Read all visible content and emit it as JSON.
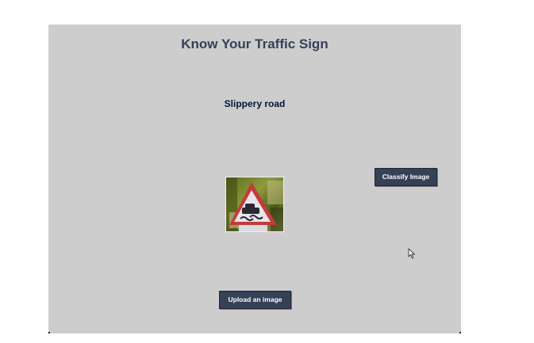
{
  "app": {
    "title": "Know Your Traffic Sign"
  },
  "result": {
    "label": "Slippery road"
  },
  "buttons": {
    "classify_label": "Classify Image",
    "upload_label": "Upload an image"
  },
  "image": {
    "icon": "slippery-road-sign-photo"
  },
  "colors": {
    "window_bg": "#cdcdcd",
    "title_color": "#364156",
    "label_color": "#011638",
    "button_bg": "#364156",
    "button_fg": "#ffffff"
  }
}
